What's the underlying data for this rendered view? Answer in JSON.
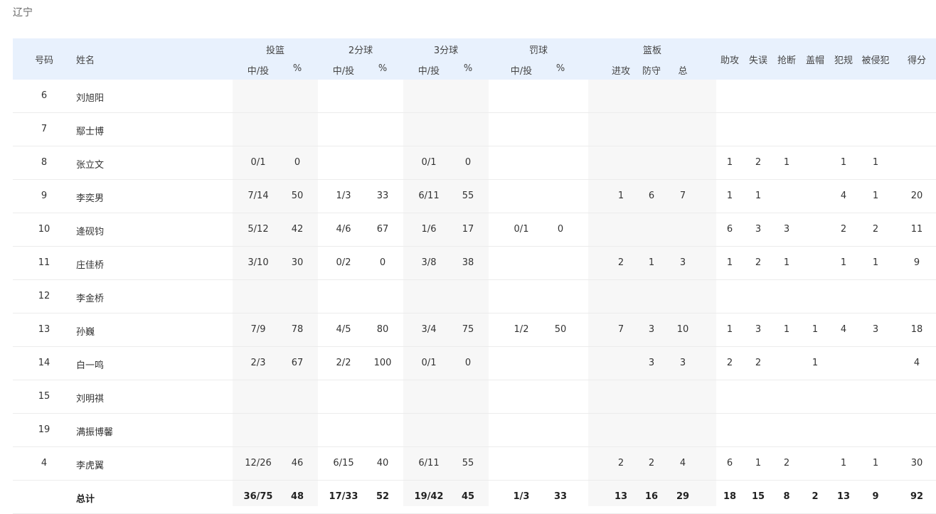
{
  "team": "辽宁",
  "headers": {
    "number": "号码",
    "name": "姓名",
    "shooting": "投篮",
    "two_pt": "2分球",
    "three_pt": "3分球",
    "free_throw": "罚球",
    "rebounds": "篮板",
    "made_att": "中/投",
    "pct": "%",
    "offensive": "进攻",
    "defensive": "防守",
    "total_reb": "总",
    "assists": "助攻",
    "turnovers": "失误",
    "steals": "抢断",
    "blocks": "盖帽",
    "fouls": "犯规",
    "fouled": "被侵犯",
    "points": "得分"
  },
  "players": [
    {
      "num": "6",
      "name": "刘旭阳",
      "fg": "",
      "fg_pct": "",
      "p2": "",
      "p2_pct": "",
      "p3": "",
      "p3_pct": "",
      "ft": "",
      "ft_pct": "",
      "oreb": "",
      "dreb": "",
      "reb": "",
      "ast": "",
      "to": "",
      "stl": "",
      "blk": "",
      "pf": "",
      "fd": "",
      "pts": ""
    },
    {
      "num": "7",
      "name": "鄢士博",
      "fg": "",
      "fg_pct": "",
      "p2": "",
      "p2_pct": "",
      "p3": "",
      "p3_pct": "",
      "ft": "",
      "ft_pct": "",
      "oreb": "",
      "dreb": "",
      "reb": "",
      "ast": "",
      "to": "",
      "stl": "",
      "blk": "",
      "pf": "",
      "fd": "",
      "pts": ""
    },
    {
      "num": "8",
      "name": "张立文",
      "fg": "0/1",
      "fg_pct": "0",
      "p2": "",
      "p2_pct": "",
      "p3": "0/1",
      "p3_pct": "0",
      "ft": "",
      "ft_pct": "",
      "oreb": "",
      "dreb": "",
      "reb": "",
      "ast": "1",
      "to": "2",
      "stl": "1",
      "blk": "",
      "pf": "1",
      "fd": "1",
      "pts": ""
    },
    {
      "num": "9",
      "name": "李奕男",
      "fg": "7/14",
      "fg_pct": "50",
      "p2": "1/3",
      "p2_pct": "33",
      "p3": "6/11",
      "p3_pct": "55",
      "ft": "",
      "ft_pct": "",
      "oreb": "1",
      "dreb": "6",
      "reb": "7",
      "ast": "1",
      "to": "1",
      "stl": "",
      "blk": "",
      "pf": "4",
      "fd": "1",
      "pts": "20"
    },
    {
      "num": "10",
      "name": "逄砚钧",
      "fg": "5/12",
      "fg_pct": "42",
      "p2": "4/6",
      "p2_pct": "67",
      "p3": "1/6",
      "p3_pct": "17",
      "ft": "0/1",
      "ft_pct": "0",
      "oreb": "",
      "dreb": "",
      "reb": "",
      "ast": "6",
      "to": "3",
      "stl": "3",
      "blk": "",
      "pf": "2",
      "fd": "2",
      "pts": "11"
    },
    {
      "num": "11",
      "name": "庄佳桥",
      "fg": "3/10",
      "fg_pct": "30",
      "p2": "0/2",
      "p2_pct": "0",
      "p3": "3/8",
      "p3_pct": "38",
      "ft": "",
      "ft_pct": "",
      "oreb": "2",
      "dreb": "1",
      "reb": "3",
      "ast": "1",
      "to": "2",
      "stl": "1",
      "blk": "",
      "pf": "1",
      "fd": "1",
      "pts": "9"
    },
    {
      "num": "12",
      "name": "李金桥",
      "fg": "",
      "fg_pct": "",
      "p2": "",
      "p2_pct": "",
      "p3": "",
      "p3_pct": "",
      "ft": "",
      "ft_pct": "",
      "oreb": "",
      "dreb": "",
      "reb": "",
      "ast": "",
      "to": "",
      "stl": "",
      "blk": "",
      "pf": "",
      "fd": "",
      "pts": ""
    },
    {
      "num": "13",
      "name": "孙巍",
      "fg": "7/9",
      "fg_pct": "78",
      "p2": "4/5",
      "p2_pct": "80",
      "p3": "3/4",
      "p3_pct": "75",
      "ft": "1/2",
      "ft_pct": "50",
      "oreb": "7",
      "dreb": "3",
      "reb": "10",
      "ast": "1",
      "to": "3",
      "stl": "1",
      "blk": "1",
      "pf": "4",
      "fd": "3",
      "pts": "18"
    },
    {
      "num": "14",
      "name": "白一鸣",
      "fg": "2/3",
      "fg_pct": "67",
      "p2": "2/2",
      "p2_pct": "100",
      "p3": "0/1",
      "p3_pct": "0",
      "ft": "",
      "ft_pct": "",
      "oreb": "",
      "dreb": "3",
      "reb": "3",
      "ast": "2",
      "to": "2",
      "stl": "",
      "blk": "1",
      "pf": "",
      "fd": "",
      "pts": "4"
    },
    {
      "num": "15",
      "name": "刘明祺",
      "fg": "",
      "fg_pct": "",
      "p2": "",
      "p2_pct": "",
      "p3": "",
      "p3_pct": "",
      "ft": "",
      "ft_pct": "",
      "oreb": "",
      "dreb": "",
      "reb": "",
      "ast": "",
      "to": "",
      "stl": "",
      "blk": "",
      "pf": "",
      "fd": "",
      "pts": ""
    },
    {
      "num": "19",
      "name": "满振博馨",
      "fg": "",
      "fg_pct": "",
      "p2": "",
      "p2_pct": "",
      "p3": "",
      "p3_pct": "",
      "ft": "",
      "ft_pct": "",
      "oreb": "",
      "dreb": "",
      "reb": "",
      "ast": "",
      "to": "",
      "stl": "",
      "blk": "",
      "pf": "",
      "fd": "",
      "pts": ""
    },
    {
      "num": "4",
      "name": "李虎翼",
      "fg": "12/26",
      "fg_pct": "46",
      "p2": "6/15",
      "p2_pct": "40",
      "p3": "6/11",
      "p3_pct": "55",
      "ft": "",
      "ft_pct": "",
      "oreb": "2",
      "dreb": "2",
      "reb": "4",
      "ast": "6",
      "to": "1",
      "stl": "2",
      "blk": "",
      "pf": "1",
      "fd": "1",
      "pts": "30"
    }
  ],
  "total": {
    "num": "",
    "name": "总计",
    "fg": "36/75",
    "fg_pct": "48",
    "p2": "17/33",
    "p2_pct": "52",
    "p3": "19/42",
    "p3_pct": "45",
    "ft": "1/3",
    "ft_pct": "33",
    "oreb": "13",
    "dreb": "16",
    "reb": "29",
    "ast": "18",
    "to": "15",
    "stl": "8",
    "blk": "2",
    "pf": "13",
    "fd": "9",
    "pts": "92"
  }
}
